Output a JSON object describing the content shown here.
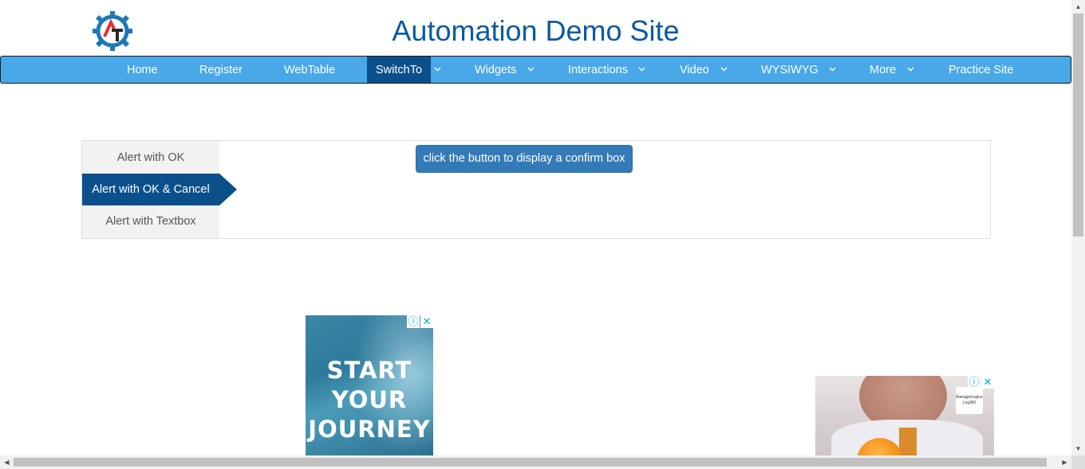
{
  "site": {
    "title": "Automation Demo Site",
    "logo_icon": "gear-logo-icon"
  },
  "nav": {
    "items": [
      {
        "label": "Home",
        "dropdown": false,
        "active": false
      },
      {
        "label": "Register",
        "dropdown": false,
        "active": false
      },
      {
        "label": "WebTable",
        "dropdown": false,
        "active": false
      },
      {
        "label": "SwitchTo",
        "dropdown": true,
        "active": true
      },
      {
        "label": "Widgets",
        "dropdown": true,
        "active": false
      },
      {
        "label": "Interactions",
        "dropdown": true,
        "active": false
      },
      {
        "label": "Video",
        "dropdown": true,
        "active": false
      },
      {
        "label": "WYSIWYG",
        "dropdown": true,
        "active": false
      },
      {
        "label": "More",
        "dropdown": true,
        "active": false
      },
      {
        "label": "Practice Site",
        "dropdown": false,
        "active": false
      }
    ]
  },
  "tabs": {
    "items": [
      {
        "label": "Alert with OK",
        "active": false
      },
      {
        "label": "Alert with OK & Cancel",
        "active": true
      },
      {
        "label": "Alert with Textbox",
        "active": false
      }
    ],
    "content_button": "click the button to display a confirm box"
  },
  "ads": {
    "ad1_lines": [
      "START",
      "YOUR",
      "JOURNEY"
    ],
    "ad2_badge": "ManageEngine Log360"
  },
  "colors": {
    "accent": "#48a8e8",
    "active": "#0b4f8b",
    "button": "#337ab7",
    "title": "#0a5aa0"
  }
}
